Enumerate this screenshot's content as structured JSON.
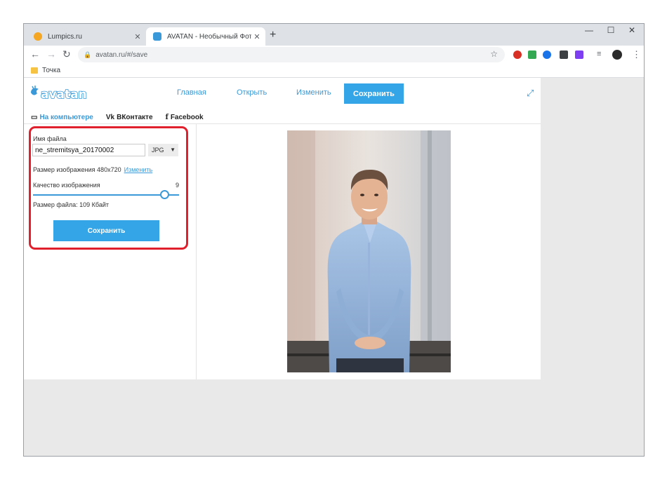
{
  "browser": {
    "tabs": [
      {
        "title": "Lumpics.ru",
        "active": false,
        "favicon_color": "#f5a623"
      },
      {
        "title": "AVATAN - Необычный Фоторед",
        "active": true,
        "favicon_color": "#3a9ad9"
      }
    ],
    "new_tab_label": "+",
    "url": "avatan.ru/#/save",
    "bookmarks": [
      {
        "label": "Точка"
      }
    ]
  },
  "app": {
    "logo_text": "avatan",
    "nav": {
      "home": "Главная",
      "open": "Открыть",
      "edit": "Изменить",
      "save": "Сохранить"
    },
    "subtabs": {
      "computer": "На компьютере",
      "vk": "ВКонтакте",
      "facebook": "Facebook"
    },
    "save_panel": {
      "filename_label": "Имя файла",
      "filename_value": "ne_stremitsya_20170002",
      "format": "JPG",
      "size_label": "Размер изображения 480x720",
      "size_change_link": "Изменить",
      "quality_label": "Качество изображения",
      "quality_value": "9",
      "quality_fraction": 0.9,
      "file_size_label": "Размер файла: 109 Кбайт",
      "save_button": "Сохранить"
    },
    "accent_color": "#34a6e8",
    "highlight_color": "#e0212d"
  }
}
